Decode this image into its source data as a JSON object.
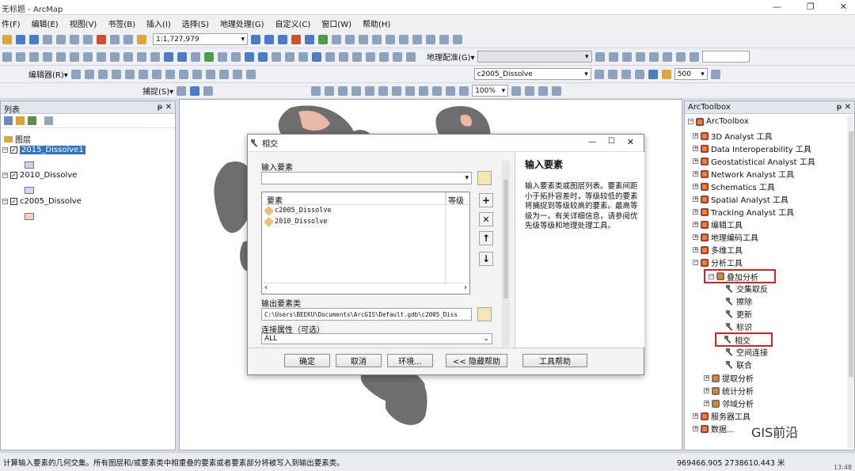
{
  "window": {
    "title": "无标题 - ArcMap",
    "min": "—",
    "max": "❐",
    "close": "✕"
  },
  "menu": [
    "件(F)",
    "编辑(E)",
    "视图(V)",
    "书签(B)",
    "插入(I)",
    "选择(S)",
    "地理处理(G)",
    "自定义(C)",
    "窗口(W)",
    "帮助(H)"
  ],
  "toolbar": {
    "scale": "1:1,727,979",
    "georef_label": "地理配准(G)▾",
    "editor_label": "编辑器(R)▾",
    "snap_label": "捕捉(S)▾",
    "layer_combo": "c2005_Dissolve",
    "value_combo": "500",
    "zoom_pct": "100%"
  },
  "toc": {
    "header": "列表",
    "pin": "ᵽ ✕",
    "root": "图层",
    "layers": [
      {
        "name": "2015_Dissolve1",
        "checked": "✓",
        "color": "#d8cef0",
        "selected": true
      },
      {
        "name": "2010_Dissolve",
        "checked": "✓",
        "color": "#d0d8f0",
        "selected": false
      },
      {
        "name": "c2005_Dissolve",
        "checked": "✓",
        "color": "#f5d0c0",
        "selected": false
      }
    ]
  },
  "dialog": {
    "title": "相交",
    "input_label": "输入要素",
    "table_col1": "要素",
    "table_col2": "等级",
    "rows": [
      "c2005_Dissolve",
      "2010_Dissolve"
    ],
    "output_label": "输出要素类",
    "output_value": "C:\\Users\\BEEKU\\Documents\\ArcGIS\\Default.gdb\\c2005_Diss",
    "join_label": "连接属性（可选）",
    "join_value": "ALL",
    "buttons": {
      "ok": "确定",
      "cancel": "取消",
      "env": "环境...",
      "hide_help": "<< 隐藏帮助",
      "tool_help": "工具帮助"
    },
    "help_title": "输入要素",
    "help_text": "输入要素类或图层列表。要素间距小于拓扑容差时，等级较低的要素将捕捉到等级较高的要素。最高等级为一。有关详细信息，请参阅优先级等级和地理处理工具。"
  },
  "arctoolbox": {
    "header": "ArcToolbox",
    "pin": "ᵽ ✕",
    "root": "ArcToolbox",
    "items": [
      "3D Analyst 工具",
      "Data Interoperability 工具",
      "Geostatistical Analyst 工具",
      "Network Analyst 工具",
      "Schematics 工具",
      "Spatial Analyst 工具",
      "Tracking Analyst 工具",
      "编辑工具",
      "地理编码工具",
      "多维工具",
      "分析工具"
    ],
    "overlay": "叠加分析",
    "overlay_tools": [
      "交集取反",
      "擦除",
      "更新",
      "标识",
      "相交",
      "空间连接",
      "联合"
    ],
    "after": [
      "提取分析",
      "统计分析",
      "邻域分析",
      "服务器工具",
      "数据..."
    ]
  },
  "status": {
    "text": "计算输入要素的几何交集。所有图层和/或要素类中相重叠的要素或者要素部分将被写入到输出要素类。",
    "coords": "969466.905  2738610.443 米",
    "watermark": "GIS前沿",
    "time": "13:48"
  }
}
